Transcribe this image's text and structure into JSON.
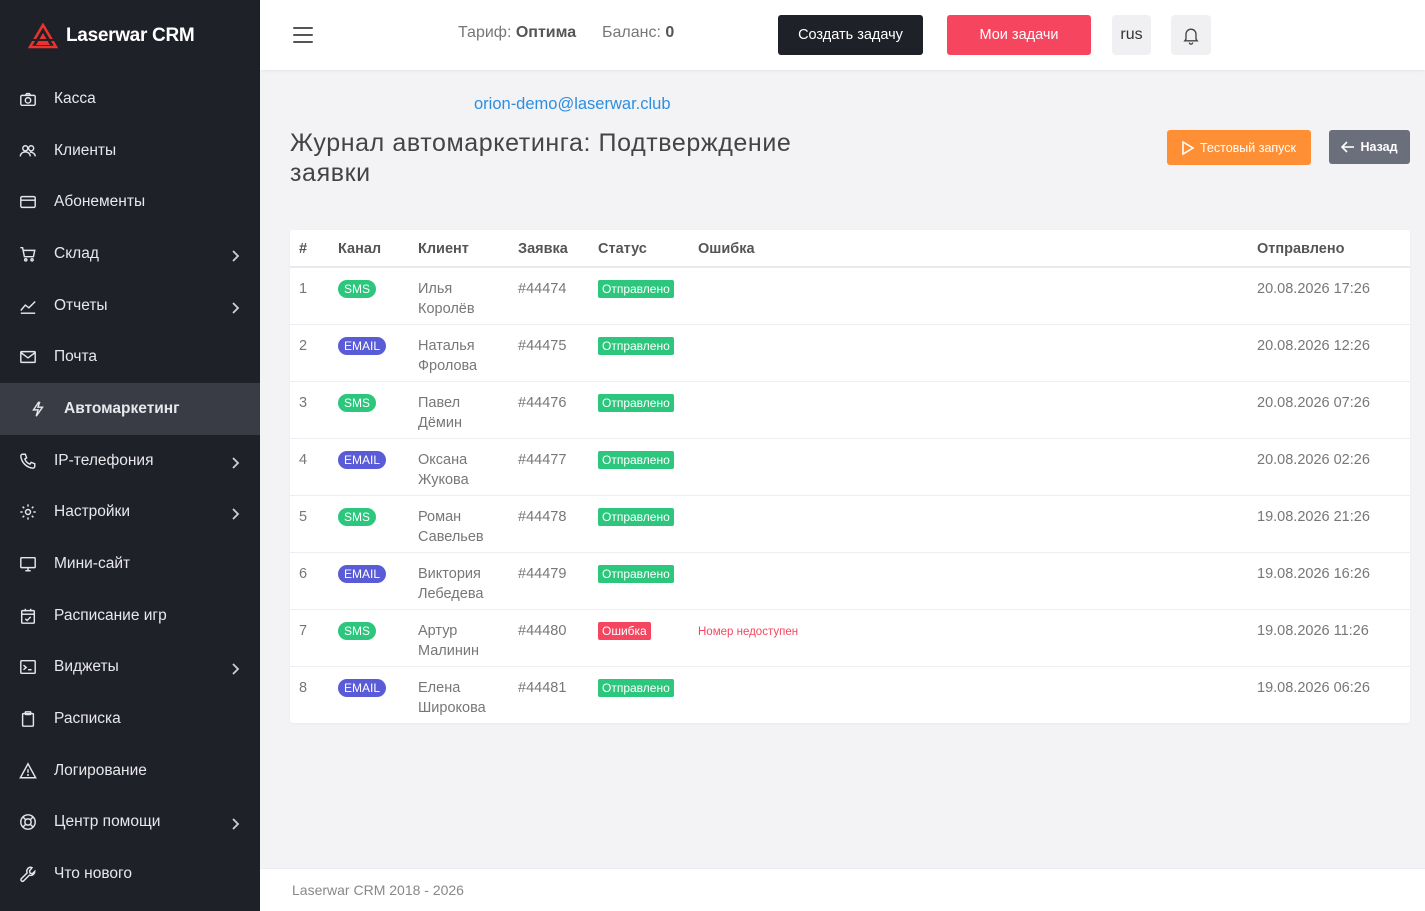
{
  "brand": {
    "name": "Laserwar CRM"
  },
  "sidebar": {
    "items": [
      {
        "label": "Касса",
        "icon": "camera-icon",
        "has_submenu": false,
        "active": false
      },
      {
        "label": "Клиенты",
        "icon": "users-icon",
        "has_submenu": false,
        "active": false
      },
      {
        "label": "Абонементы",
        "icon": "card-icon",
        "has_submenu": false,
        "active": false
      },
      {
        "label": "Склад",
        "icon": "cart-icon",
        "has_submenu": true,
        "active": false
      },
      {
        "label": "Отчеты",
        "icon": "chart-icon",
        "has_submenu": true,
        "active": false
      },
      {
        "label": "Почта",
        "icon": "mail-icon",
        "has_submenu": false,
        "active": false
      },
      {
        "label": "Автомаркетинг",
        "icon": "flash-icon",
        "has_submenu": false,
        "active": true
      },
      {
        "label": "IP-телефония",
        "icon": "phone-icon",
        "has_submenu": true,
        "active": false
      },
      {
        "label": "Настройки",
        "icon": "gear-icon",
        "has_submenu": true,
        "active": false
      },
      {
        "label": "Мини-сайт",
        "icon": "monitor-icon",
        "has_submenu": false,
        "active": false
      },
      {
        "label": "Расписание игр",
        "icon": "calendar-check-icon",
        "has_submenu": false,
        "active": false
      },
      {
        "label": "Виджеты",
        "icon": "terminal-icon",
        "has_submenu": true,
        "active": false
      },
      {
        "label": "Расписка",
        "icon": "clipboard-icon",
        "has_submenu": false,
        "active": false
      },
      {
        "label": "Логирование",
        "icon": "warning-icon",
        "has_submenu": false,
        "active": false
      },
      {
        "label": "Центр помощи",
        "icon": "lifebuoy-icon",
        "has_submenu": true,
        "active": false
      },
      {
        "label": "Что нового",
        "icon": "wrench-icon",
        "has_submenu": false,
        "active": false
      }
    ]
  },
  "header": {
    "tariff_label": "Тариф:",
    "tariff_value": "Оптима",
    "balance_label": "Баланс:",
    "balance_value": "0",
    "create_task": "Создать задачу",
    "my_tasks": "Мои задачи",
    "lang": "rus"
  },
  "page": {
    "email": "orion-demo@laserwar.club",
    "title": "Журнал автомаркетинга: Подтверждение заявки",
    "test_run": "Тестовый запуск",
    "back": "Назад"
  },
  "table": {
    "columns": [
      "#",
      "Канал",
      "Клиент",
      "Заявка",
      "Статус",
      "Ошибка",
      "Отправлено"
    ],
    "rows": [
      {
        "num": "1",
        "channel": "SMS",
        "client_first": "Илья",
        "client_last": "Королёв",
        "order": "#44474",
        "status": "Отправлено",
        "status_ok": true,
        "error": "",
        "sent": "20.08.2026 17:26"
      },
      {
        "num": "2",
        "channel": "EMAIL",
        "client_first": "Наталья",
        "client_last": "Фролова",
        "order": "#44475",
        "status": "Отправлено",
        "status_ok": true,
        "error": "",
        "sent": "20.08.2026 12:26"
      },
      {
        "num": "3",
        "channel": "SMS",
        "client_first": "Павел",
        "client_last": "Дёмин",
        "order": "#44476",
        "status": "Отправлено",
        "status_ok": true,
        "error": "",
        "sent": "20.08.2026 07:26"
      },
      {
        "num": "4",
        "channel": "EMAIL",
        "client_first": "Оксана",
        "client_last": "Жукова",
        "order": "#44477",
        "status": "Отправлено",
        "status_ok": true,
        "error": "",
        "sent": "20.08.2026 02:26"
      },
      {
        "num": "5",
        "channel": "SMS",
        "client_first": "Роман",
        "client_last": "Савельев",
        "order": "#44478",
        "status": "Отправлено",
        "status_ok": true,
        "error": "",
        "sent": "19.08.2026 21:26"
      },
      {
        "num": "6",
        "channel": "EMAIL",
        "client_first": "Виктория",
        "client_last": "Лебедева",
        "order": "#44479",
        "status": "Отправлено",
        "status_ok": true,
        "error": "",
        "sent": "19.08.2026 16:26"
      },
      {
        "num": "7",
        "channel": "SMS",
        "client_first": "Артур",
        "client_last": "Малинин",
        "order": "#44480",
        "status": "Ошибка",
        "status_ok": false,
        "error": "Номер недоступен",
        "sent": "19.08.2026 11:26"
      },
      {
        "num": "8",
        "channel": "EMAIL",
        "client_first": "Елена",
        "client_last": "Широкова",
        "order": "#44481",
        "status": "Отправлено",
        "status_ok": true,
        "error": "",
        "sent": "19.08.2026 06:26"
      }
    ]
  },
  "footer": {
    "text": "Laserwar CRM 2018 - 2026"
  },
  "colors": {
    "sidebar_bg": "#1f2128",
    "active_bg": "#3a3c45",
    "accent_red": "#f6465f",
    "accent_orange": "#ff8f34",
    "success": "#2cc77d",
    "email_badge": "#5a5bd6",
    "link": "#2d8ee0"
  }
}
